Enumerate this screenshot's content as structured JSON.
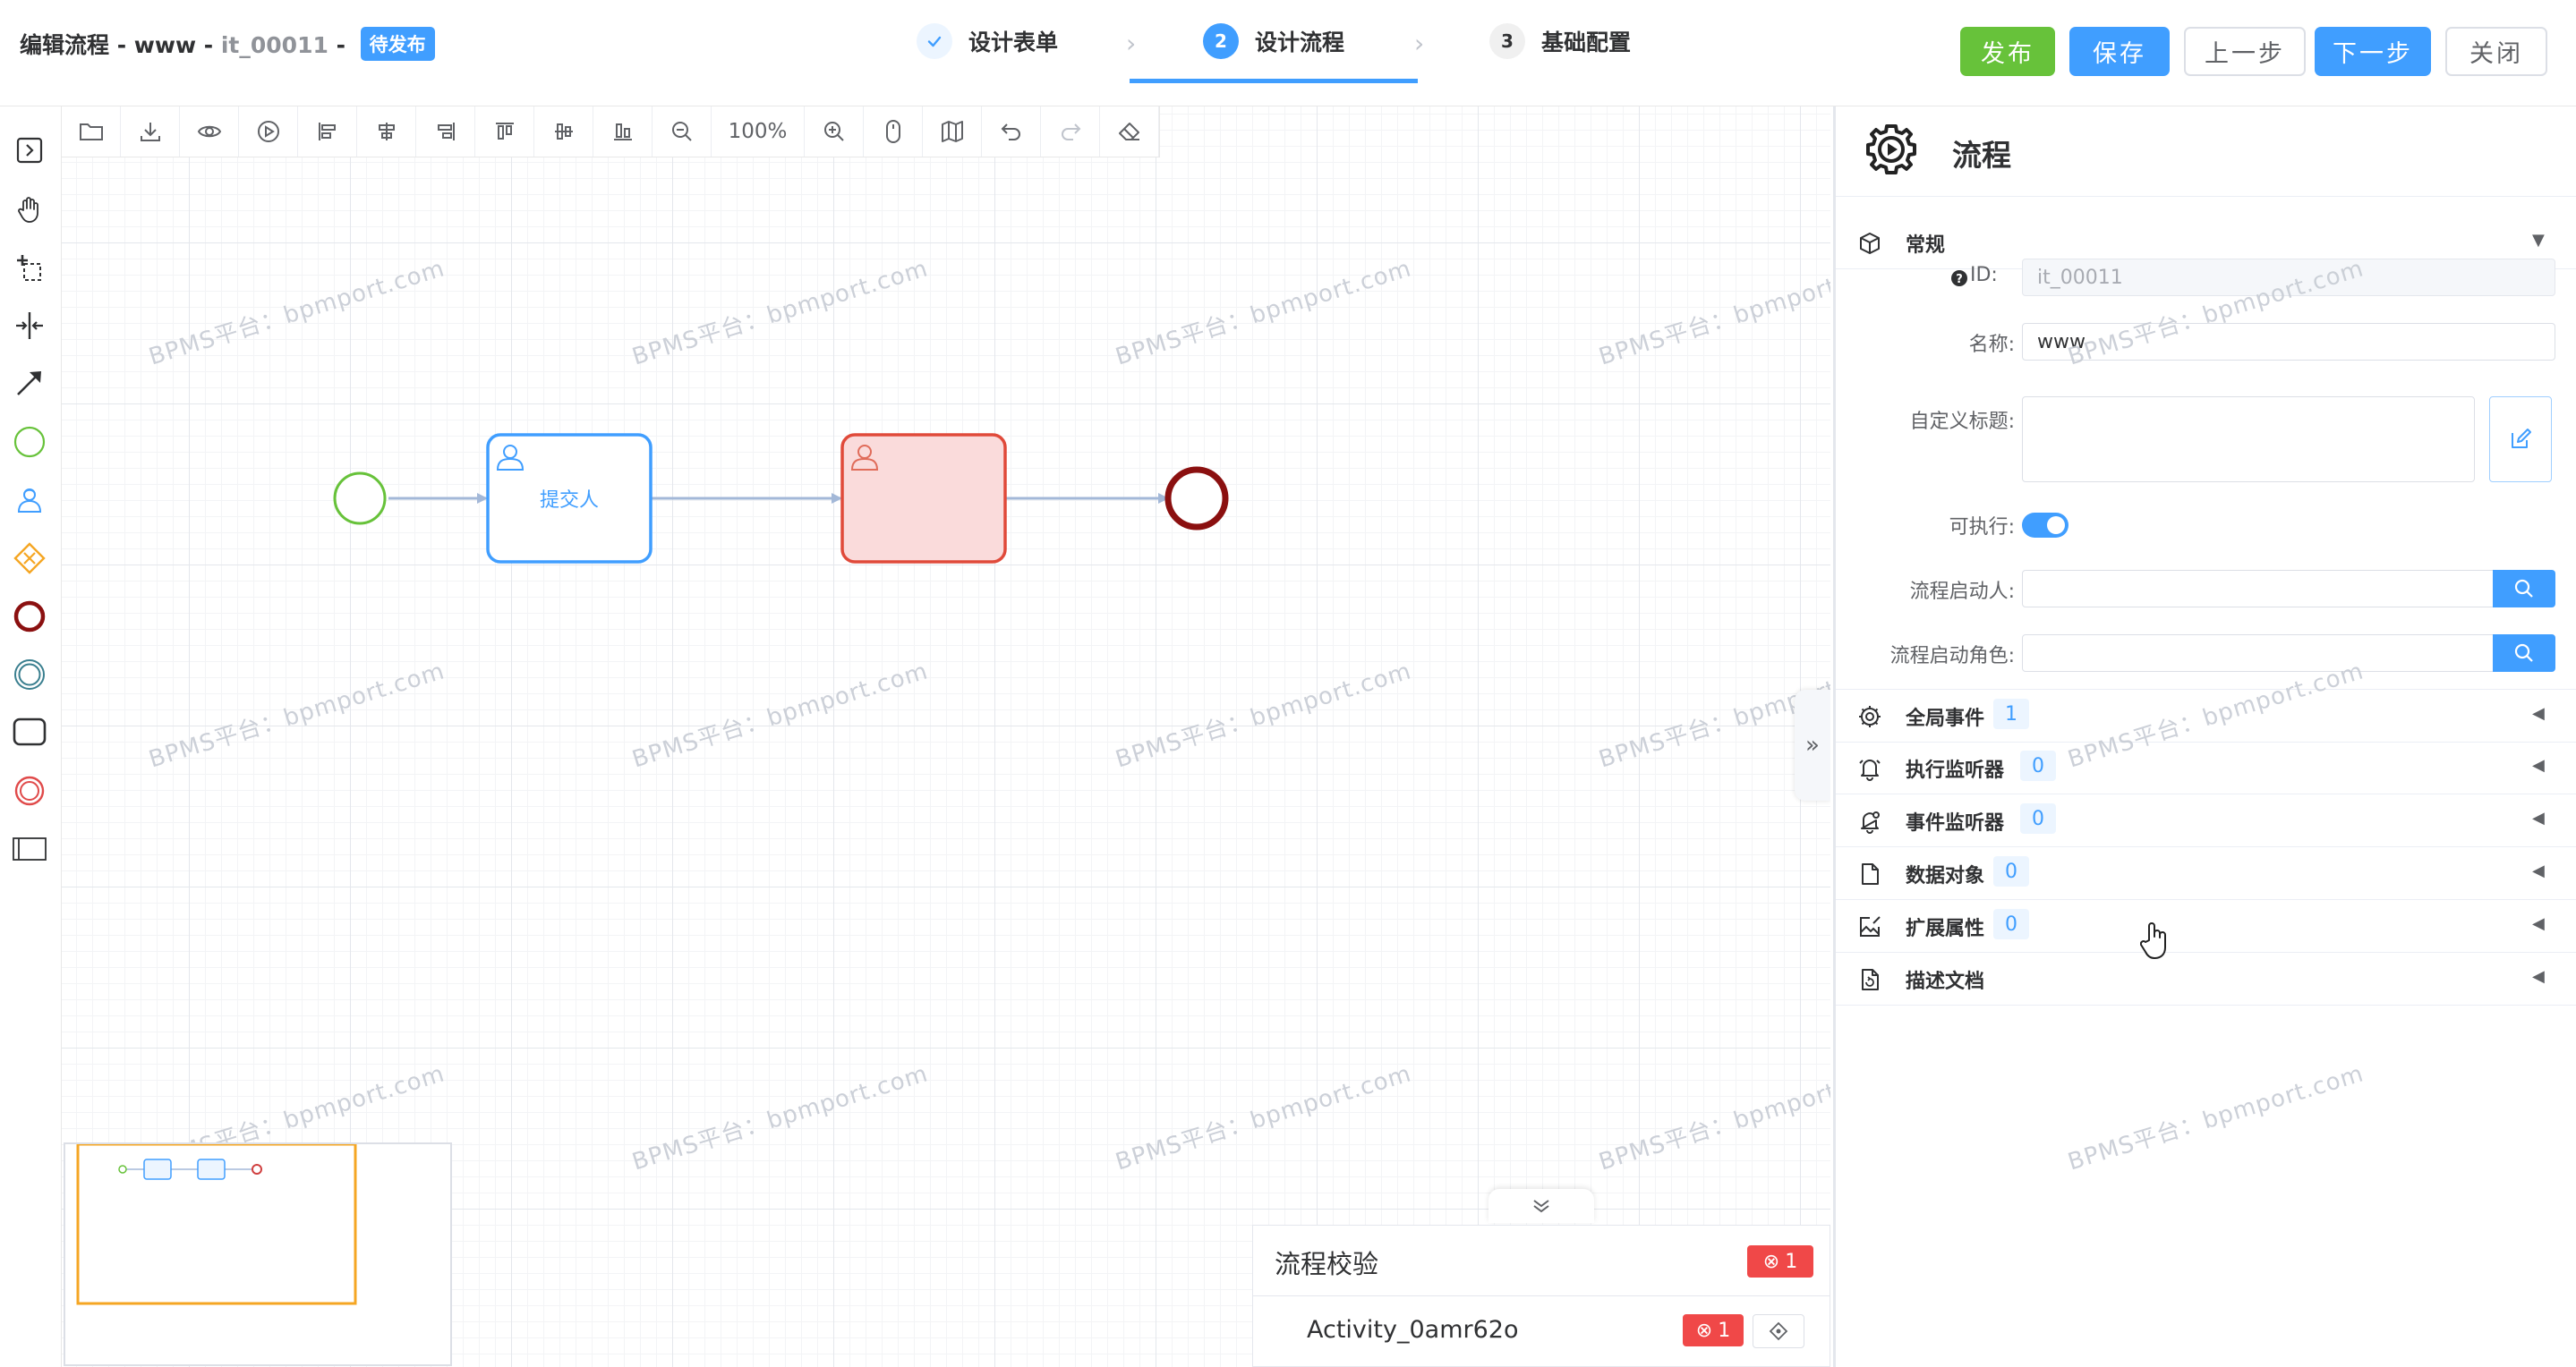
{
  "header": {
    "title_prefix": "编辑流程 - www - ",
    "title_id": "it_00011",
    "title_suffix": " -",
    "status_badge": "待发布",
    "steps": [
      {
        "label": "设计表单",
        "num": "✓"
      },
      {
        "label": "设计流程",
        "num": "2"
      },
      {
        "label": "基础配置",
        "num": "3"
      }
    ],
    "buttons": {
      "publish": "发布",
      "save": "保存",
      "prev": "上一步",
      "next": "下一步",
      "close": "关闭"
    }
  },
  "toolbar": {
    "zoom": "100%"
  },
  "diagram": {
    "task1_label": "提交人",
    "watermark": "BPMS平台：bpmport.com"
  },
  "validation": {
    "title": "流程校验",
    "total_errors": "1",
    "item_name": "Activity_0amr62o",
    "item_errors": "1"
  },
  "panel": {
    "title": "流程",
    "general_section": "常规",
    "fields": {
      "id_label": "ID:",
      "id_value": "it_00011",
      "name_label": "名称:",
      "name_value": "www",
      "custom_title_label": "自定义标题:",
      "executable_label": "可执行:",
      "starter_label": "流程启动人:",
      "starter_role_label": "流程启动角色:"
    },
    "sections": [
      {
        "label": "全局事件",
        "count": "1"
      },
      {
        "label": "执行监听器",
        "count": "0"
      },
      {
        "label": "事件监听器",
        "count": "0"
      },
      {
        "label": "数据对象",
        "count": "0"
      },
      {
        "label": "扩展属性",
        "count": "0"
      },
      {
        "label": "描述文档",
        "count": ""
      }
    ]
  },
  "colors": {
    "primary": "#409eff",
    "success": "#67c23a",
    "danger": "#f04848",
    "start_event": "#67c23a",
    "end_event": "#8b1010"
  }
}
